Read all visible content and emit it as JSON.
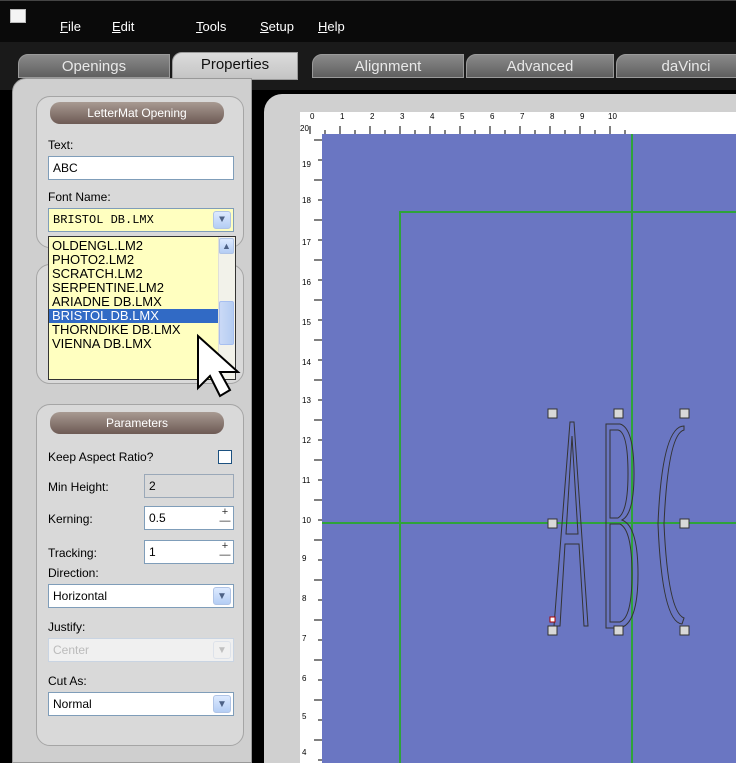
{
  "menu": {
    "file": {
      "underline": "F",
      "rest": "ile"
    },
    "edit": {
      "underline": "E",
      "rest": "dit"
    },
    "tools": {
      "underline": "T",
      "rest": "ools"
    },
    "setup": {
      "underline": "S",
      "rest": "etup"
    },
    "help": {
      "underline": "H",
      "rest": "elp"
    }
  },
  "tabs": [
    {
      "label": "Openings"
    },
    {
      "label": "Properties"
    },
    {
      "label": "Alignment"
    },
    {
      "label": "Advanced"
    },
    {
      "label": "daVinci"
    }
  ],
  "letter_mat": {
    "title": "LetterMat Opening",
    "text_label": "Text:",
    "text_value": "ABC",
    "font_label": "Font Name:",
    "font_value": "BRISTOL DB.LMX",
    "font_options": [
      "OLDENGL.LM2",
      "PHOTO2.LM2",
      "SCRATCH.LM2",
      "SERPENTINE.LM2",
      "ARIADNE DB.LMX",
      "BRISTOL DB.LMX",
      "THORNDIKE DB.LMX",
      "VIENNA DB.LMX"
    ],
    "selected_index": 5
  },
  "parameters": {
    "title": "Parameters",
    "keep_aspect_label": "Keep Aspect Ratio?",
    "keep_aspect_checked": false,
    "min_height_label": "Min Height:",
    "min_height_value": "2",
    "kerning_label": "Kerning:",
    "kerning_value": "0.5",
    "tracking_label": "Tracking:",
    "tracking_value": "1",
    "direction_label": "Direction:",
    "direction_value": "Horizontal",
    "justify_label": "Justify:",
    "justify_value": "Center",
    "cut_as_label": "Cut As:",
    "cut_as_value": "Normal"
  },
  "ruler": {
    "top": [
      "0",
      "1",
      "2",
      "3",
      "4",
      "5",
      "6",
      "7",
      "8",
      "9",
      "10"
    ],
    "left": [
      "20",
      "19",
      "18",
      "17",
      "16",
      "15",
      "14",
      "13",
      "12",
      "11",
      "10",
      "9",
      "8",
      "7",
      "6",
      "5",
      "4"
    ]
  },
  "canvas_text": "ABC",
  "colors": {
    "canvas": "#6a76c2",
    "guide": "#2ea33a",
    "selection": "#316ac5",
    "dropdown_bg": "#ffffc0"
  }
}
